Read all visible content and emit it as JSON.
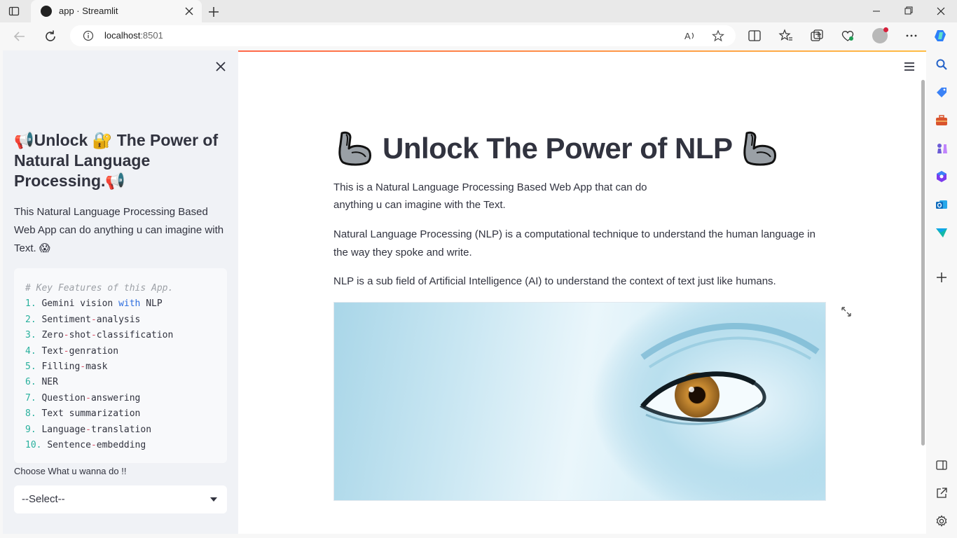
{
  "browser": {
    "tab_title": "app · Streamlit",
    "url_host": "localhost",
    "url_port": ":8501"
  },
  "sidebar": {
    "title": "📢Unlock 🔐 The Power of Natural Language Processing.📢",
    "description": "This Natural Language Processing Based Web App can do anything u can imagine with Text. 😱",
    "code_comment": "# Key Features of this App.",
    "features": [
      {
        "num": "1.",
        "parts": [
          [
            "Gemini vision ",
            ""
          ],
          [
            "with",
            "kw"
          ],
          [
            " NLP",
            ""
          ]
        ]
      },
      {
        "num": "2.",
        "parts": [
          [
            "Sentiment",
            ""
          ],
          [
            "-",
            "op"
          ],
          [
            "analysis",
            ""
          ]
        ]
      },
      {
        "num": "3.",
        "parts": [
          [
            "Zero",
            ""
          ],
          [
            "-",
            "op"
          ],
          [
            "shot",
            ""
          ],
          [
            "-",
            "op"
          ],
          [
            "classification",
            ""
          ]
        ]
      },
      {
        "num": "4.",
        "parts": [
          [
            "Text",
            ""
          ],
          [
            "-",
            "op"
          ],
          [
            "genration",
            ""
          ]
        ]
      },
      {
        "num": "5.",
        "parts": [
          [
            "Filling",
            ""
          ],
          [
            "-",
            "op"
          ],
          [
            "mask",
            ""
          ]
        ]
      },
      {
        "num": "6.",
        "parts": [
          [
            "NER",
            ""
          ]
        ]
      },
      {
        "num": "7.",
        "parts": [
          [
            "Question",
            ""
          ],
          [
            "-",
            "op"
          ],
          [
            "answering",
            ""
          ]
        ]
      },
      {
        "num": "8.",
        "parts": [
          [
            "Text summarization",
            ""
          ]
        ]
      },
      {
        "num": "9.",
        "parts": [
          [
            "Language",
            ""
          ],
          [
            "-",
            "op"
          ],
          [
            "translation",
            ""
          ]
        ]
      },
      {
        "num": "10.",
        "parts": [
          [
            " Sentence",
            ""
          ],
          [
            "-",
            "op"
          ],
          [
            "embedding",
            ""
          ]
        ]
      }
    ],
    "select_label": "Choose What u wanna do !!",
    "select_value": "--Select--"
  },
  "main": {
    "heading": "Unlock The Power of NLP",
    "paragraph1": "This is a Natural Language Processing Based Web App that can do anything u can imagine with the Text.",
    "paragraph2": "Natural Language Processing (NLP) is a computational technique to understand the human language in the way they spoke and write.",
    "paragraph3": "NLP is a sub field of Artificial Intelligence (AI) to understand the context of text just like humans."
  },
  "colors": {
    "accent": "#ff4b4b",
    "text": "#31333f",
    "sidebar_bg": "#f0f2f6"
  }
}
